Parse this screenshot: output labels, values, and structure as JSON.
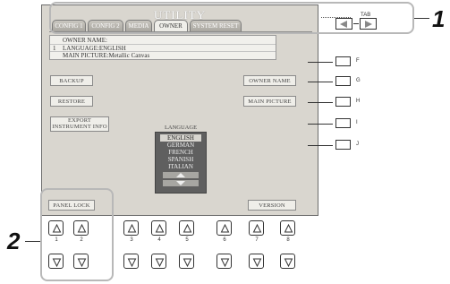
{
  "screen": {
    "title": "UTILITY",
    "tabs": [
      "CONFIG 1",
      "CONFIG 2",
      "MEDIA",
      "OWNER",
      "SYSTEM RESET"
    ],
    "active_tab": "OWNER",
    "info": {
      "number": "1",
      "owner_name": "OWNER NAME:",
      "language": "LANGUAGE:ENGLISH",
      "main_picture": "MAIN PICTURE:Metallic Canvas"
    },
    "buttons": {
      "backup": "BACKUP",
      "restore": "RESTORE",
      "export_line1": "EXPORT",
      "export_line2": "INSTRUMENT INFO",
      "owner_name": "OWNER NAME",
      "main_picture": "MAIN PICTURE",
      "panel_lock": "PANEL LOCK",
      "version": "VERSION"
    },
    "language_label": "LANGUAGE",
    "languages": [
      "ENGLISH",
      "GERMAN",
      "FRENCH",
      "SPANISH",
      "ITALIAN"
    ],
    "selected_language": "ENGLISH"
  },
  "tab_control": {
    "label": "TAB"
  },
  "side_buttons": [
    "F",
    "G",
    "H",
    "I",
    "J"
  ],
  "bottom_buttons": [
    "1",
    "2",
    "3",
    "4",
    "5",
    "6",
    "7",
    "8"
  ],
  "callouts": {
    "first": "1",
    "second": "2"
  }
}
